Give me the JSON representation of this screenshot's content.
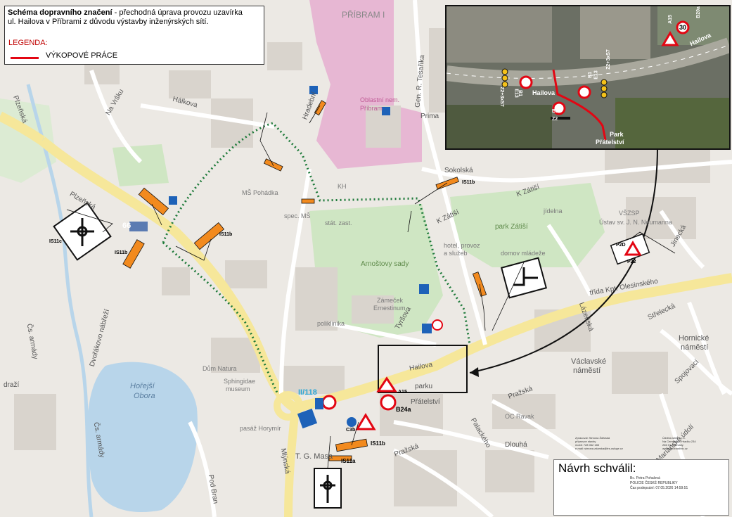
{
  "header": {
    "title_bold": "Schéma dopravního značení",
    "title_rest": " - přechodná úprava provozu uzavírka",
    "subtitle": "ul. Hailova v Příbrami z důvodu výstavby inženýrských sítí.",
    "legend_title": "LEGENDA:",
    "legend_item": "VÝKOPOVÉ PRÁCE"
  },
  "colors": {
    "excavation": "#e30613",
    "detour": "#1e7a3a",
    "road_major": "#f6e79a",
    "hospital": "#e7b7d3",
    "park": "#cfe6c3",
    "water": "#b8d5ea",
    "building": "#d9d4cd",
    "sign_orange": "#f28a1e"
  },
  "places": [
    {
      "key": "pribram",
      "text": "PŘÍBRAM I"
    },
    {
      "key": "hospital",
      "text": "Oblastní nem."
    },
    {
      "key": "hospital2",
      "text": "Příbram"
    },
    {
      "key": "park_zatisi",
      "text": "park Zátiší"
    },
    {
      "key": "arnost",
      "text": "Arnoštovy sady"
    },
    {
      "key": "zamecek",
      "text": "Zámeček"
    },
    {
      "key": "ernestinum",
      "text": "Ernestinum"
    },
    {
      "key": "hornicke",
      "text": "Hornické"
    },
    {
      "key": "hornicke2",
      "text": "náměstí"
    },
    {
      "key": "vaclavske",
      "text": "Václavské"
    },
    {
      "key": "vaclavske2",
      "text": "náměstí"
    },
    {
      "key": "tgm",
      "text": "T. G. Masa"
    },
    {
      "key": "horejsi",
      "text": "Hořejší"
    },
    {
      "key": "obora",
      "text": "Obora"
    },
    {
      "key": "sphingidae",
      "text": "Sphingidae"
    },
    {
      "key": "museum",
      "text": "museum"
    },
    {
      "key": "dum_natura",
      "text": "Dům Natura"
    },
    {
      "key": "pasaz",
      "text": "pasáž Horymír"
    },
    {
      "key": "poliklinika",
      "text": "poliklinika"
    },
    {
      "key": "kh",
      "text": "KH"
    },
    {
      "key": "ms_pohadka",
      "text": "MŠ Pohádka"
    },
    {
      "key": "spec_ms",
      "text": "spec. MŠ"
    },
    {
      "key": "stat_zast",
      "text": "stát. zast."
    },
    {
      "key": "hotel",
      "text": "hotel, provoz"
    },
    {
      "key": "hotel2",
      "text": "a služeb"
    },
    {
      "key": "domov",
      "text": "domov mládeže"
    },
    {
      "key": "vsps",
      "text": "VŠZSP"
    },
    {
      "key": "ustav",
      "text": "Ústav sv. J. N. Neumanna"
    },
    {
      "key": "jidelna",
      "text": "jídelna"
    },
    {
      "key": "oc_ravak",
      "text": "OC Ravak"
    },
    {
      "key": "route",
      "text": "II/118"
    },
    {
      "key": "road66",
      "text": "66"
    }
  ],
  "streets": [
    {
      "key": "plzenska1",
      "text": "Plzeňská"
    },
    {
      "key": "plzenska2",
      "text": "Plzeňská"
    },
    {
      "key": "na_vrsku",
      "text": "Na Vršku"
    },
    {
      "key": "halkova",
      "text": "Hálkova"
    },
    {
      "key": "hradebni",
      "text": "Hradební"
    },
    {
      "key": "gen_tesarika",
      "text": "Gen. R. Tesaříka"
    },
    {
      "key": "prima",
      "text": "Prima"
    },
    {
      "key": "sokolska",
      "text": "Sokolská"
    },
    {
      "key": "k_zatisi",
      "text": "K Zátiší"
    },
    {
      "key": "k_zatisi2",
      "text": "K Zátiší"
    },
    {
      "key": "trida",
      "text": "třída Kpt. Olesinského"
    },
    {
      "key": "jinecka",
      "text": "Jinecká"
    },
    {
      "key": "hailova",
      "text": "Hailova"
    },
    {
      "key": "tyrsova",
      "text": "Tyršova"
    },
    {
      "key": "prazska",
      "text": "Pražská"
    },
    {
      "key": "prazska2",
      "text": "Pražská"
    },
    {
      "key": "dlouha",
      "text": "Dlouhá"
    },
    {
      "key": "palackeho",
      "text": "Palackého"
    },
    {
      "key": "mlynska",
      "text": "Mlýnská"
    },
    {
      "key": "dvorakovo",
      "text": "Dvořákovo nábřeží"
    },
    {
      "key": "cs_armady",
      "text": "Čs. armády"
    },
    {
      "key": "cs_armady2",
      "text": "Čs. armády"
    },
    {
      "key": "streleck",
      "text": "Střelecká"
    },
    {
      "key": "spojovaci",
      "text": "Spojovací"
    },
    {
      "key": "marianske",
      "text": "Mariánské údolí"
    },
    {
      "key": "lazenska",
      "text": "Lázeňská"
    },
    {
      "key": "pod_brana",
      "text": "Pod Bran"
    },
    {
      "key": "draz",
      "text": "draží"
    },
    {
      "key": "pratelstvi",
      "text": "Přátelství"
    },
    {
      "key": "parku",
      "text": "parku"
    }
  ],
  "signs": {
    "is11a_labels": [
      "IS11a",
      "IS11b",
      "IS11b",
      "IS11b",
      "IS11b",
      "IS11b",
      "IS11b"
    ],
    "b24a": "B24a",
    "a15": "A15",
    "b24b": "B24b",
    "p22": "P22",
    "p2d": "P2D",
    "c3b": "C3b",
    "is11a": "IS11a",
    "is11b": "IS11b",
    "is11c": "IS11c"
  },
  "inset": {
    "street": "Hailova",
    "street2": "Hailova",
    "park": "Park",
    "pratelstvi": "Přátelství",
    "tags": [
      "B1",
      "E13",
      "Z2+3xS7",
      "B1",
      "E13",
      "Z2+3xS7",
      "B1",
      "Z2",
      "A15",
      "B20a",
      "30"
    ]
  },
  "approval": {
    "title": "Návrh schválil:",
    "name": "Bc. Petra Pohalová",
    "org": "POLICIE ČESKÉ REPUBLIKY",
    "date": "Čas podepsání: 07.05.2026 14:59:51"
  },
  "footer": {
    "col1": [
      "Zpracoval: Simona Žďárská",
      "přípravce stavby",
      "mobil: 728 062 183",
      "e-mail: simona.zdarska@trs-usluge.cz"
    ],
    "col2": [
      "Údržba silnic s.r.o.",
      "Na Cementám Hradku 234",
      "266 01 Suchdoly",
      "www.udrzbasilnic.cz"
    ]
  }
}
